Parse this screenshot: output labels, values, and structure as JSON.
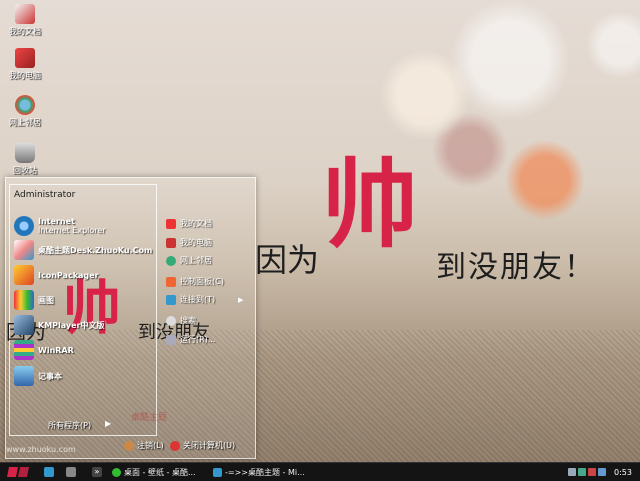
{
  "desktop": {
    "icons": [
      {
        "label": "我的文档"
      },
      {
        "label": "我的电脑"
      },
      {
        "label": "网上邻居"
      },
      {
        "label": "回收站"
      }
    ]
  },
  "wallpaper": {
    "big_char": "帅",
    "left_text": "因为",
    "right_text": "到没朋友！",
    "url": "www.zhuoku.com"
  },
  "start_menu": {
    "user": "Administrator",
    "pinned": [
      {
        "title": "Internet",
        "subtitle": "Internet Explorer"
      },
      {
        "title": "桌酷主题Desk.ZhuoKu.Com"
      },
      {
        "title": "IconPackager"
      },
      {
        "title": "画图"
      },
      {
        "title": "KMPlayer中文版"
      },
      {
        "title": "WinRAR"
      },
      {
        "title": "记事本"
      }
    ],
    "right_items": [
      {
        "label": "我的文档",
        "arrow": false
      },
      {
        "label": "我的电脑",
        "arrow": false
      },
      {
        "label": "网上邻居",
        "arrow": false
      },
      {
        "label": "控制面板(C)",
        "arrow": false
      },
      {
        "label": "连接到(T)",
        "arrow": true
      },
      {
        "label": "搜索",
        "arrow": false
      },
      {
        "label": "运行(R)...",
        "arrow": false
      }
    ],
    "all_programs": "所有程序(P)",
    "all_programs_arrow": "▶",
    "logoff": "注销(L)",
    "shutdown": "关闭计算机(U)",
    "overlay": {
      "big_char": "帅",
      "left": "因为",
      "right": "到没朋友"
    },
    "watermark": "桌酷主题"
  },
  "taskbar": {
    "buttons": [
      {
        "label": "桌面 - 壁纸 - 桌酷..."
      },
      {
        "label": "-=>>桌酷主题 - Mi..."
      }
    ],
    "clock": "0:53"
  },
  "colors": {
    "accent": "#d82348",
    "taskbar": "#141414"
  }
}
